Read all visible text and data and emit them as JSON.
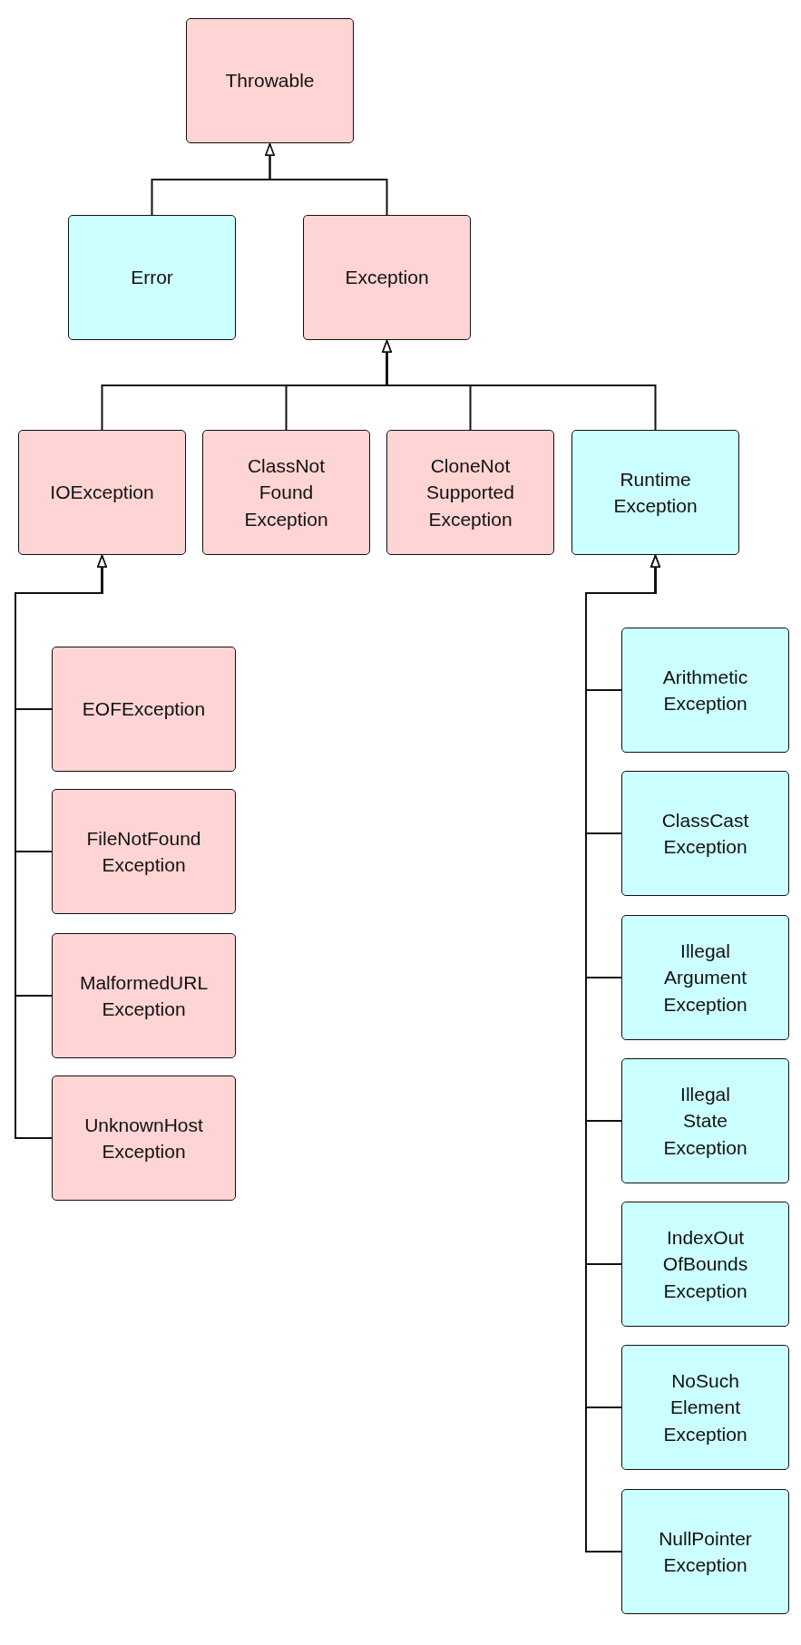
{
  "diagram": {
    "root": {
      "label": "Throwable",
      "color": "#ffd4d4",
      "children": [
        {
          "label": "Error",
          "color": "#ccffff"
        },
        {
          "label": "Exception",
          "color": "#ffd4d4",
          "children": [
            {
              "label": "IOException",
              "color": "#ffd4d4",
              "children": [
                {
                  "label": "EOFException",
                  "color": "#ffd4d4"
                },
                {
                  "label": "FileNotFound\nException",
                  "color": "#ffd4d4"
                },
                {
                  "label": "MalformedURL\nException",
                  "color": "#ffd4d4"
                },
                {
                  "label": "UnknownHost\nException",
                  "color": "#ffd4d4"
                }
              ]
            },
            {
              "label": "ClassNot\nFound\nException",
              "color": "#ffd4d4"
            },
            {
              "label": "CloneNot\nSupported\nException",
              "color": "#ffd4d4"
            },
            {
              "label": "Runtime\nException",
              "color": "#ccffff",
              "children": [
                {
                  "label": "Arithmetic\nException",
                  "color": "#ccffff"
                },
                {
                  "label": "ClassCast\nException",
                  "color": "#ccffff"
                },
                {
                  "label": "Illegal\nArgument\nException",
                  "color": "#ccffff"
                },
                {
                  "label": "Illegal\nState\nException",
                  "color": "#ccffff"
                },
                {
                  "label": "IndexOut\nOfBounds\nException",
                  "color": "#ccffff"
                },
                {
                  "label": "NoSuch\nElement\nException",
                  "color": "#ccffff"
                },
                {
                  "label": "NullPointer\nException",
                  "color": "#ccffff"
                }
              ]
            }
          ]
        }
      ]
    }
  }
}
